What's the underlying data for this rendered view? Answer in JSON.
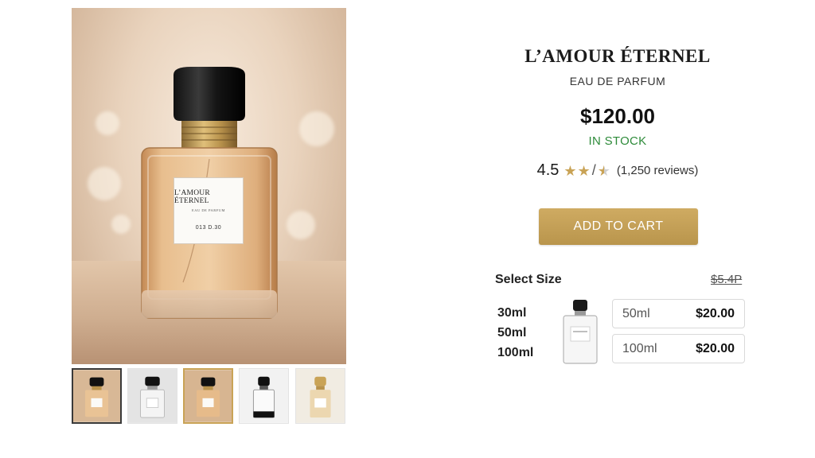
{
  "product": {
    "title": "L’AMOUR ÉTERNEL",
    "subtitle": "EAU DE PARFUM",
    "price": "$120.00",
    "stock_status": "IN STOCK",
    "rating": {
      "score": "4.5",
      "stars_visible": [
        "full",
        "full",
        "slash",
        "half"
      ],
      "reviews": "(1,250 reviews)"
    },
    "add_to_cart_label": "ADD TO CART"
  },
  "image_label": {
    "brand": "L’AMOUR ÉTERNEL",
    "sub": "EAU DE PARFUM",
    "volume": "013 D.30"
  },
  "size_section": {
    "label": "Select Size",
    "old_price": "$5.4P",
    "sizes": [
      "30ml",
      "50ml",
      "100ml"
    ],
    "options": [
      {
        "size": "50ml",
        "price": "$20.00"
      },
      {
        "size": "100ml",
        "price": "$20.00"
      }
    ]
  },
  "thumbnails": [
    {
      "name": "thumb-warm-1",
      "state": "selected"
    },
    {
      "name": "thumb-clear",
      "state": "normal"
    },
    {
      "name": "thumb-warm-2",
      "state": "active"
    },
    {
      "name": "thumb-black",
      "state": "normal"
    },
    {
      "name": "thumb-gold",
      "state": "normal"
    }
  ],
  "colors": {
    "accent_gold": "#c9a356",
    "stock_green": "#2e8b3a",
    "button_gold": "#bf9b52"
  }
}
